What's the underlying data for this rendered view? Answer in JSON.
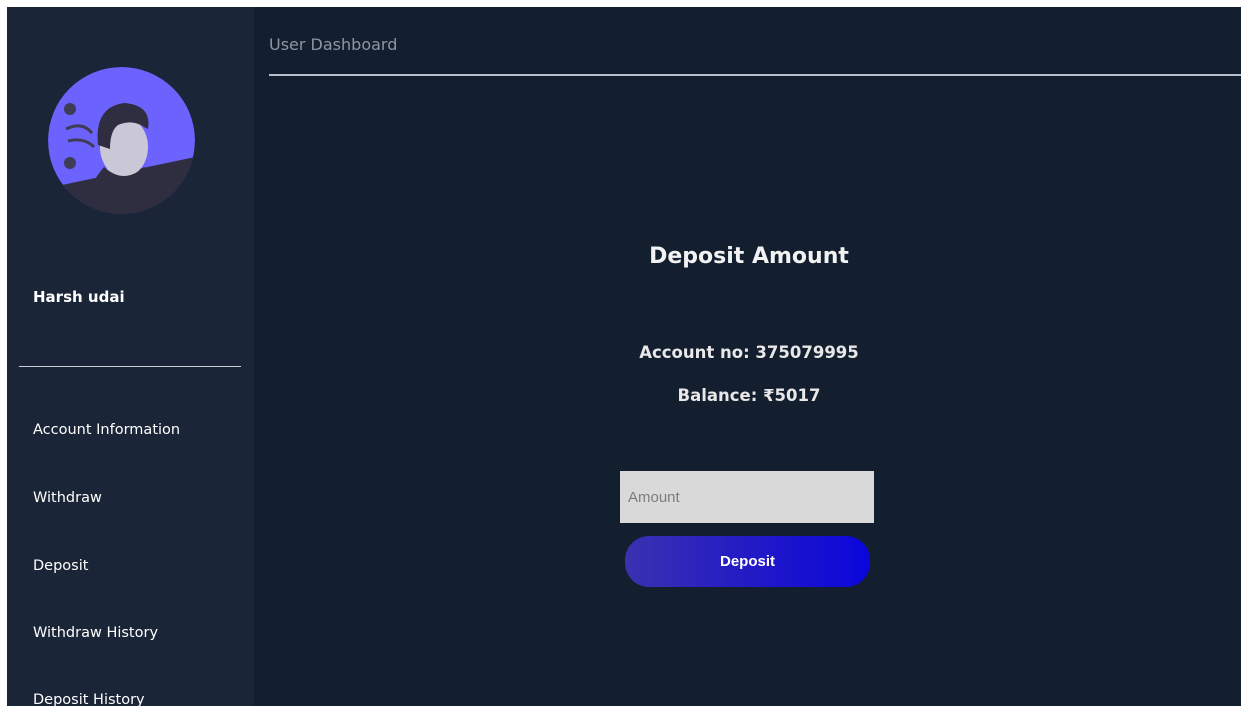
{
  "header": {
    "title": "User Dashboard"
  },
  "sidebar": {
    "user_name": "Harsh udai",
    "avatar_icon": "user-avatar-icon",
    "items": [
      {
        "label": "Account Information"
      },
      {
        "label": "Withdraw"
      },
      {
        "label": "Deposit"
      },
      {
        "label": "Withdraw History"
      },
      {
        "label": "Deposit History"
      }
    ]
  },
  "main": {
    "title": "Deposit Amount",
    "account_line": "Account no: 375079995",
    "balance_line": "Balance: ₹5017",
    "amount_input": {
      "placeholder": "Amount",
      "value": ""
    },
    "submit_label": "Deposit"
  },
  "colors": {
    "background": "#131e2f",
    "sidebar": "#1a2537",
    "button_gradient_start": "#3a32b0",
    "button_gradient_end": "#0a06dc",
    "avatar_bg": "#6c63ff"
  }
}
